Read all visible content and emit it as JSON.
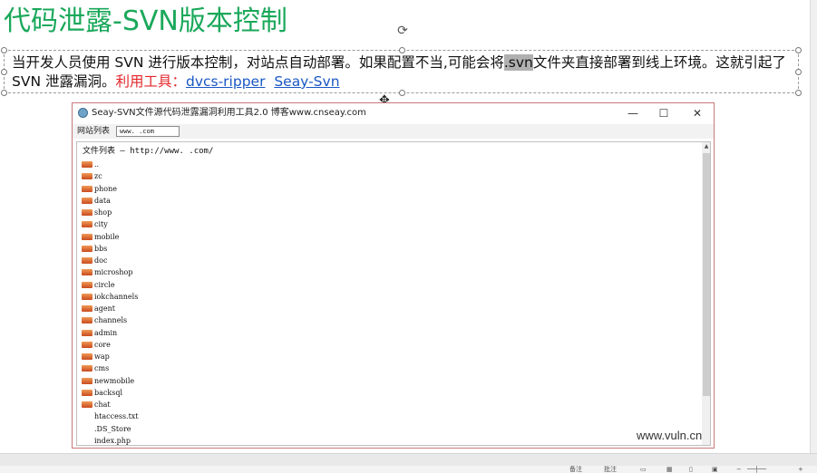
{
  "slide": {
    "title": "代码泄露-SVN版本控制",
    "body_part1": "当开发人员使用 SVN 进行版本控制，对站点自动部署。如果配置不当,可能会将",
    "body_highlight": ".svn",
    "body_part2": "文件夹直接部署到线上环境。这就引起了 SVN 泄露漏洞。",
    "tools_label": "利用工具：",
    "tool1": "dvcs-ripper",
    "tool2": "Seay-Svn"
  },
  "app": {
    "title": "Seay-SVN文件源代码泄露漏洞利用工具2.0  博客www.cnseay.com",
    "site_list_label": "网站列表",
    "site_url": "www.      .com",
    "file_list_header": "文件列表 — http://www.       .com/",
    "files": [
      {
        "name": "..",
        "type": "folder"
      },
      {
        "name": "zc",
        "type": "folder"
      },
      {
        "name": "phone",
        "type": "folder"
      },
      {
        "name": "data",
        "type": "folder"
      },
      {
        "name": "shop",
        "type": "folder"
      },
      {
        "name": "city",
        "type": "folder"
      },
      {
        "name": "mobile",
        "type": "folder"
      },
      {
        "name": "bbs",
        "type": "folder"
      },
      {
        "name": "doc",
        "type": "folder"
      },
      {
        "name": "microshop",
        "type": "folder"
      },
      {
        "name": "circle",
        "type": "folder"
      },
      {
        "name": "iokchannels",
        "type": "folder"
      },
      {
        "name": "agent",
        "type": "folder"
      },
      {
        "name": "channels",
        "type": "folder"
      },
      {
        "name": "admin",
        "type": "folder"
      },
      {
        "name": "core",
        "type": "folder"
      },
      {
        "name": "wap",
        "type": "folder"
      },
      {
        "name": "cms",
        "type": "folder"
      },
      {
        "name": "newmobile",
        "type": "folder"
      },
      {
        "name": "backsql",
        "type": "folder"
      },
      {
        "name": "chat",
        "type": "folder"
      },
      {
        "name": "htaccess.txt",
        "type": "file"
      },
      {
        "name": ".DS_Store",
        "type": "file"
      },
      {
        "name": "index.php",
        "type": "file"
      }
    ],
    "watermark": "www.vuln.cn"
  },
  "colors": {
    "title_green": "#1aa85a",
    "tool_red": "#e3262b",
    "link_blue": "#1a57c4"
  },
  "statusbar": {
    "notes": "备注",
    "comments": "批注"
  }
}
